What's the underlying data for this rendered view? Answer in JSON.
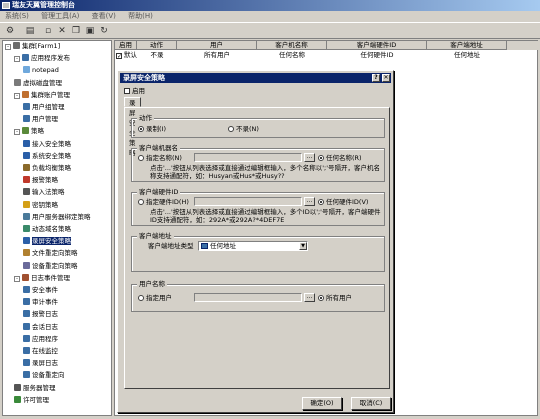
{
  "window": {
    "title": "瑞友天翼管理控制台"
  },
  "menu": [
    "系统(S)",
    "管理工具(A)",
    "查看(V)",
    "帮助(H)"
  ],
  "toolbar": [
    "settings-icon",
    "properties-icon",
    "new-icon",
    "delete-icon",
    "copy-icon",
    "paste-icon",
    "refresh-icon"
  ],
  "tree": [
    {
      "label": "集群[Farm1]",
      "icon": "server-farm-icon",
      "level": 0,
      "expander": "-"
    },
    {
      "label": "应用程序发布",
      "icon": "app-icon",
      "level": 1,
      "expander": "-"
    },
    {
      "label": "notepad",
      "icon": "notepad-icon",
      "level": 2,
      "expander": ""
    },
    {
      "label": "虚拟磁盘管理",
      "icon": "disk-icon",
      "level": 1,
      "expander": ""
    },
    {
      "label": "集群账户管理",
      "icon": "account-icon",
      "level": 1,
      "expander": "-"
    },
    {
      "label": "用户组管理",
      "icon": "group-icon",
      "level": 2,
      "expander": ""
    },
    {
      "label": "用户管理",
      "icon": "user-icon",
      "level": 2,
      "expander": ""
    },
    {
      "label": "策略",
      "icon": "policy-icon",
      "level": 1,
      "expander": "-"
    },
    {
      "label": "接入安全策略",
      "icon": "shield-icon",
      "level": 2,
      "expander": ""
    },
    {
      "label": "系统安全策略",
      "icon": "shield-icon",
      "level": 2,
      "expander": ""
    },
    {
      "label": "负载均衡策略",
      "icon": "balance-icon",
      "level": 2,
      "expander": ""
    },
    {
      "label": "报警策略",
      "icon": "alarm-icon",
      "level": 2,
      "expander": ""
    },
    {
      "label": "输入法策略",
      "icon": "keyboard-icon",
      "level": 2,
      "expander": ""
    },
    {
      "label": "密钥策略",
      "icon": "key-icon",
      "level": 2,
      "expander": ""
    },
    {
      "label": "用户服务器绑定策略",
      "icon": "bind-icon",
      "level": 2,
      "expander": ""
    },
    {
      "label": "动态域名策略",
      "icon": "dns-icon",
      "level": 2,
      "expander": ""
    },
    {
      "label": "录屏安全策略",
      "icon": "record-icon",
      "level": 2,
      "expander": "",
      "selected": true
    },
    {
      "label": "文件重定向策略",
      "icon": "file-icon",
      "level": 2,
      "expander": ""
    },
    {
      "label": "设备重定向策略",
      "icon": "device-icon",
      "level": 2,
      "expander": ""
    },
    {
      "label": "日志事件管理",
      "icon": "log-icon",
      "level": 1,
      "expander": "-"
    },
    {
      "label": "安全事件",
      "icon": "event-icon",
      "level": 2,
      "expander": ""
    },
    {
      "label": "审计事件",
      "icon": "event-icon",
      "level": 2,
      "expander": ""
    },
    {
      "label": "报警日志",
      "icon": "event-icon",
      "level": 2,
      "expander": ""
    },
    {
      "label": "会话日志",
      "icon": "event-icon",
      "level": 2,
      "expander": ""
    },
    {
      "label": "应用程序",
      "icon": "event-icon",
      "level": 2,
      "expander": ""
    },
    {
      "label": "在线监控",
      "icon": "event-icon",
      "level": 2,
      "expander": ""
    },
    {
      "label": "录屏日志",
      "icon": "event-icon",
      "level": 2,
      "expander": ""
    },
    {
      "label": "设备重定向",
      "icon": "event-icon",
      "level": 2,
      "expander": ""
    },
    {
      "label": "服务器管理",
      "icon": "server-icon",
      "level": 1,
      "expander": ""
    },
    {
      "label": "许可管理",
      "icon": "license-icon",
      "level": 1,
      "expander": ""
    }
  ],
  "grid": {
    "columns": [
      "启用",
      "动作",
      "用户",
      "客户机名称",
      "客户端硬件ID",
      "客户端地址"
    ],
    "rows": [
      {
        "enabled": "默认",
        "action": "不录",
        "user": "所有用户",
        "client_name": "任何名称",
        "hw_id": "任何硬件ID",
        "address": "任何地址"
      }
    ]
  },
  "dialog": {
    "title": "录屏安全策略",
    "help_glyph": "?",
    "close_glyph": "✕",
    "enable_label": "启用",
    "tab": "录屏安全策略",
    "action": {
      "title": "动作",
      "record": "录制(I)",
      "no_record": "不录(N)",
      "selected": "record"
    },
    "client_name": {
      "title": "客户端机器名",
      "specify": "指定名称(N)",
      "any": "任何名称(R)",
      "selected": "any",
      "ellipsis": "...",
      "hint1": "点击'...'按钮从列表选择或直接通过编辑框输入，多个名称以';'号隔开，客户机名",
      "hint2": "称支持通配符，如：Husyan或Hus*或Husy??"
    },
    "hardware": {
      "title": "客户端硬件ID",
      "specify": "指定硬件ID(H)",
      "any": "任何硬件ID(V)",
      "selected": "any",
      "ellipsis": "...",
      "hint1": "点击'...'按钮从列表选择或直接通过编辑框输入，多个ID以';'号隔开，客户端硬件",
      "hint2": "ID支持通配符，如：292A*或292A?*4DEF7E"
    },
    "address": {
      "title": "客户端地址",
      "type_label": "客户端地址类型",
      "type_value": "任何地址"
    },
    "user": {
      "title": "用户名称",
      "specify": "指定用户",
      "all": "所有用户",
      "selected": "all",
      "ellipsis": "..."
    },
    "ok": "确定(O)",
    "cancel": "取消(C)"
  }
}
